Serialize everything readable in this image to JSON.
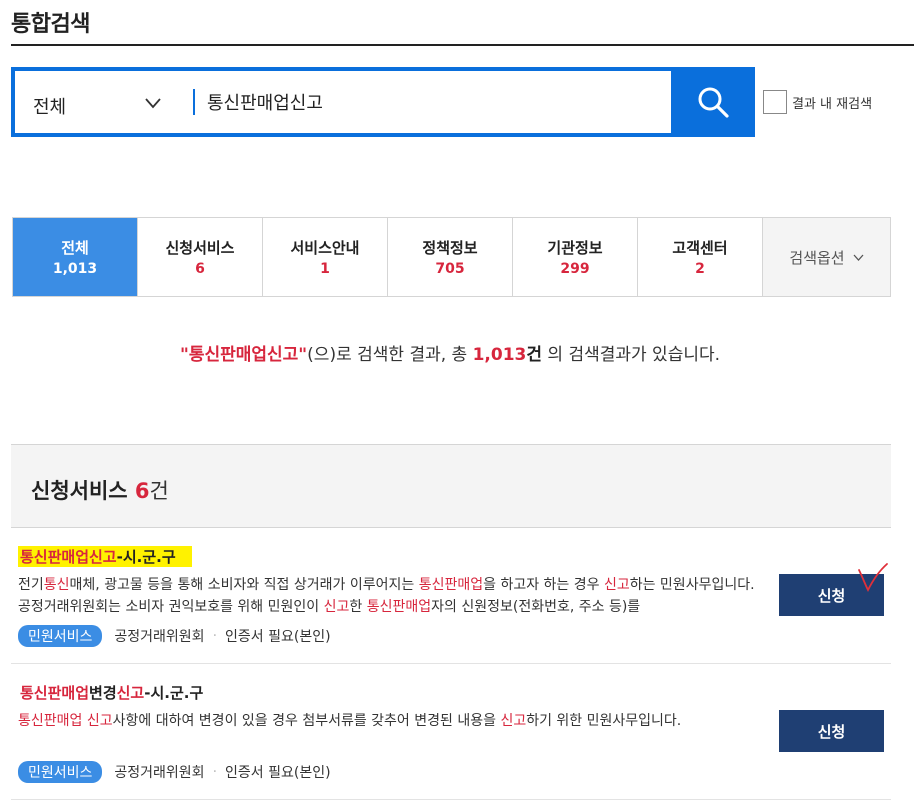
{
  "page": {
    "title": "통합검색"
  },
  "search": {
    "scope_value": "전체",
    "query": "통신판매업신고",
    "research_label": "결과 내 재검색"
  },
  "tabs": [
    {
      "label": "전체",
      "count": "1,013"
    },
    {
      "label": "신청서비스",
      "count": "6"
    },
    {
      "label": "서비스안내",
      "count": "1"
    },
    {
      "label": "정책정보",
      "count": "705"
    },
    {
      "label": "기관정보",
      "count": "299"
    },
    {
      "label": "고객센터",
      "count": "2"
    }
  ],
  "search_options_label": "검색옵션",
  "summary": {
    "keyword": "\"통신판매업신고\"",
    "text1": "(으)로 검색한 결과, 총 ",
    "count": "1,013",
    "unit": "건",
    "text2": " 의 검색결과가 있습니다."
  },
  "section": {
    "title": "신청서비스 ",
    "count": "6",
    "unit": "건"
  },
  "items": [
    {
      "title_parts": [
        "통신판매업신고",
        "-시.군.구"
      ],
      "desc_parts": [
        "전기",
        "통신",
        "매체, 광고물 등을 통해 소비자와 직접 상거래가 이루어지는 ",
        "통신판매업",
        "을 하고자 하는 경우 ",
        "신고",
        "하는 민원사무입니다. 공정거래위원회는 소비자 권익보호를 위해 민원인이 ",
        "신고",
        "한 ",
        "통신판매업",
        "자의 신원정보(전화번호, 주소 등)를"
      ],
      "badge": "민원서비스",
      "org": "공정거래위원회",
      "cert": "인증서 필요(본인)",
      "button": "신청"
    },
    {
      "title_parts": [
        "통신판매업",
        "변경",
        "신고",
        "-시.군.구"
      ],
      "desc_parts": [
        "통신판매업 신고",
        "사항에 대하여 변경이 있을 경우 첨부서류를 갖추어 변경된 내용을 ",
        "신고",
        "하기 위한 민원사무입니다."
      ],
      "badge": "민원서비스",
      "org": "공정거래위원회",
      "cert": "인증서 필요(본인)",
      "button": "신청"
    }
  ],
  "colors": {
    "accent": "#0a6fdc",
    "highlight": "#d7263d",
    "button": "#1f3f73",
    "tab_active": "#3b8de4"
  }
}
